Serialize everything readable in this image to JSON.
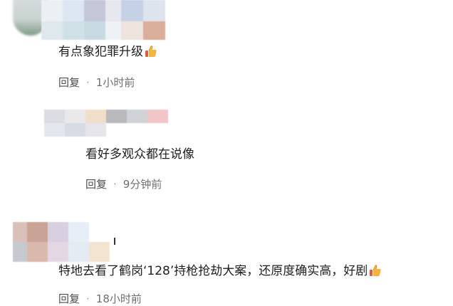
{
  "comments": [
    {
      "text": "有点象犯罪升级",
      "reply_label": "回复",
      "separator": "·",
      "time": "1小时前",
      "emoji": "thumbs-up-icon"
    },
    {
      "text": "看好多观众都在说像",
      "reply_label": "回复",
      "separator": "·",
      "time": "9分钟前"
    },
    {
      "text": "特地去看了鹤岗‘128’持枪抢劫大案，还原度确实高，好剧",
      "reply_label": "回复",
      "separator": "·",
      "time": "18小时前",
      "emoji": "thumbs-up-icon"
    }
  ],
  "colors": {
    "text": "#202020",
    "meta": "#6f6f6f",
    "background": "#ffffff"
  }
}
